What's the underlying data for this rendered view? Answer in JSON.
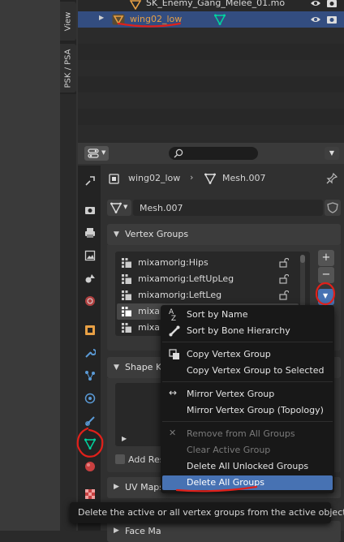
{
  "npanel_tabs": {
    "view": "View",
    "psk": "PSK / PSA"
  },
  "outliner": {
    "rows": [
      {
        "label": "SK_Enemy_Gang_Melee_01.mo"
      },
      {
        "label": "wing02_low",
        "selected": true
      }
    ]
  },
  "properties": {
    "breadcrumb": {
      "object": "wing02_low",
      "mesh": "Mesh.007"
    },
    "mesh_name": "Mesh.007",
    "vertex_groups": {
      "title": "Vertex Groups",
      "items": [
        "mixamorig:Hips",
        "mixamorig:LeftUpLeg",
        "mixamorig:LeftLeg",
        "mixa",
        "mixa"
      ],
      "add_symbol": "+",
      "remove_symbol": "−"
    },
    "shape_keys": {
      "title": "Shape Ke"
    },
    "add_rest": "Add Res",
    "uv_maps": {
      "title": "UV Maps"
    },
    "face_maps": {
      "title": "Face Ma"
    }
  },
  "menu": {
    "items": [
      {
        "label": "Sort by Name",
        "icon": "sort-alpha-icon",
        "enabled": true
      },
      {
        "label": "Sort by Bone Hierarchy",
        "icon": "bone-icon",
        "enabled": true
      },
      {
        "label": "Copy Vertex Group",
        "icon": "copy-icon",
        "enabled": true
      },
      {
        "label": "Copy Vertex Group to Selected",
        "icon": "",
        "enabled": true
      },
      {
        "label": "Mirror Vertex Group",
        "icon": "mirror-arrows-icon",
        "enabled": true
      },
      {
        "label": "Mirror Vertex Group (Topology)",
        "icon": "",
        "enabled": true
      },
      {
        "label": "Remove from All Groups",
        "icon": "x-icon",
        "enabled": false
      },
      {
        "label": "Clear Active Group",
        "icon": "",
        "enabled": false
      },
      {
        "label": "Delete All Unlocked Groups",
        "icon": "",
        "enabled": true
      },
      {
        "label": "Delete All Groups",
        "icon": "",
        "enabled": true,
        "highlighted": true
      }
    ]
  },
  "tooltip": "Delete the active or all vertex groups from the active object.",
  "colors": {
    "selection": "#334d80",
    "highlight": "#4772b3",
    "annotation": "#e0201a",
    "mesh_icon": "#00d4a0"
  }
}
